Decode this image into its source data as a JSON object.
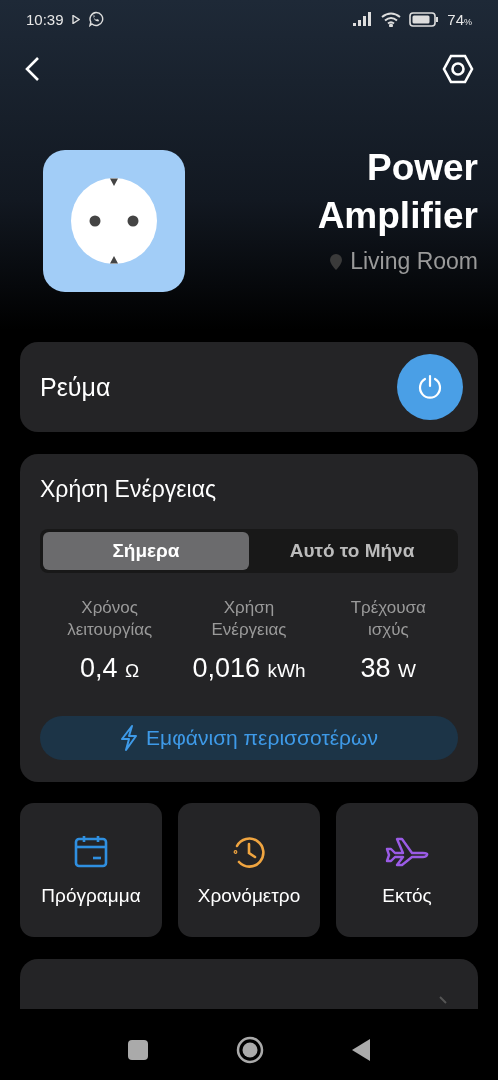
{
  "status_bar": {
    "time": "10:39",
    "battery": "74",
    "battery_unit": "%"
  },
  "device": {
    "name": "Power Amplifier",
    "room": "Living Room"
  },
  "power": {
    "label": "Ρεύμα",
    "on": true
  },
  "energy": {
    "title": "Χρήση Ενέργειας",
    "tabs": [
      {
        "label": "Σήμερα",
        "selected": true
      },
      {
        "label": "Αυτό το Μήνα",
        "selected": false
      }
    ],
    "stats": [
      {
        "label": "Χρόνος λειτουργίας",
        "value": "0,4",
        "unit": "Ω"
      },
      {
        "label": "Χρήση Ενέργειας",
        "value": "0,016",
        "unit": "kWh"
      },
      {
        "label": "Τρέχουσα ισχύς",
        "value": "38",
        "unit": "W"
      }
    ],
    "more_button": "Εμφάνιση περισσοτέρων"
  },
  "tiles": [
    {
      "kind": "calendar",
      "label": "Πρόγραμμα",
      "color": "#2f8fe0"
    },
    {
      "kind": "clock",
      "label": "Χρονόμετρο",
      "color": "#f0a540"
    },
    {
      "kind": "plane",
      "label": "Εκτός",
      "color": "#9b5be6"
    }
  ]
}
